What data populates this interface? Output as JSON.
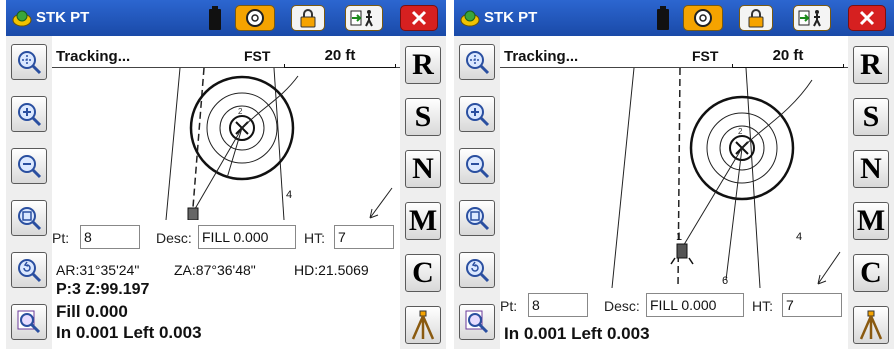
{
  "left": {
    "app_title": "STK PT",
    "status": {
      "tracking": "Tracking...",
      "mode": "FST",
      "scale": "20 ft"
    },
    "map_labels": {
      "point_2": "2",
      "point_4": "4"
    },
    "fields": {
      "pt_label": "Pt:",
      "pt_value": "8",
      "desc_label": "Desc:",
      "desc_value": "FILL 0.000",
      "ht_label": "HT:",
      "ht_value": "7"
    },
    "readout": {
      "ar": "AR:31°35'24\"",
      "za": "ZA:87°36'48\"",
      "hd": "HD:21.5069",
      "pz": "P:3 Z:99.197",
      "fill": "Fill 0.000",
      "inleft": "In 0.001 Left 0.003"
    }
  },
  "right": {
    "app_title": "STK PT",
    "status": {
      "tracking": "Tracking...",
      "mode": "FST",
      "scale": "20 ft"
    },
    "map_labels": {
      "point_2": "2",
      "point_4": "4",
      "point_1": "1",
      "point_6": "6"
    },
    "fields": {
      "pt_label": "Pt:",
      "pt_value": "8",
      "desc_label": "Desc:",
      "desc_value": "FILL 0.000",
      "ht_label": "HT:",
      "ht_value": "7"
    },
    "readout": {
      "inleft": "In 0.001 Left 0.003"
    }
  },
  "right_toolbar_letters": [
    "R",
    "S",
    "N",
    "M",
    "C"
  ],
  "icons": {
    "logo": "stake-logo-icon",
    "battery": "battery-icon",
    "target": "target-icon",
    "lock": "lock-icon",
    "walk": "walking-person-icon",
    "close": "close-icon",
    "zoom_extents": "zoom-extents-icon",
    "zoom_in": "zoom-in-icon",
    "zoom_out": "zoom-out-icon",
    "zoom_window": "zoom-window-icon",
    "zoom_previous": "zoom-previous-icon",
    "zoom_realtime": "zoom-realtime-icon",
    "tripod": "tripod-icon"
  },
  "colors": {
    "titlebar": "#1f55b8",
    "close": "#d62020",
    "accent_button": "#f5a300"
  }
}
